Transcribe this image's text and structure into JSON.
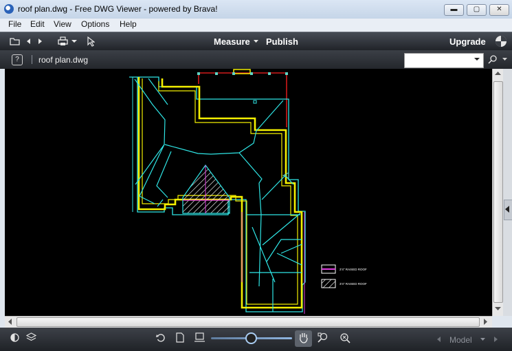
{
  "window": {
    "title": "roof plan.dwg - Free DWG Viewer - powered by Brava!",
    "controls": {
      "minimize": "▬",
      "maximize": "▢",
      "close": "✕"
    }
  },
  "menu": [
    "File",
    "Edit",
    "View",
    "Options",
    "Help"
  ],
  "toolbar": {
    "measure_label": "Measure",
    "publish_label": "Publish",
    "upgrade_label": "Upgrade",
    "icons": [
      "open-folder-icon",
      "back-arrow-icon",
      "forward-arrow-icon",
      "print-icon",
      "dropdown-caret-icon",
      "pointer-icon",
      "brava-logo-icon"
    ]
  },
  "docbar": {
    "help_label": "?",
    "file_name": "roof plan.dwg",
    "search_value": "",
    "icons": [
      "search-icon"
    ]
  },
  "drawing": {
    "legend": [
      {
        "text": "2'4\" RAISED ROOF"
      },
      {
        "text": "3'4\" RAISED ROOF"
      }
    ],
    "colors": {
      "cyan": "#2fe6e6",
      "yellow": "#f4f000",
      "red": "#d21a1a",
      "magenta": "#e040e0",
      "white": "#ffffff"
    }
  },
  "statusbar": {
    "model_label": "Model",
    "icons": [
      "contrast-icon",
      "layers-icon",
      "rotate-icon",
      "page-icon",
      "fit-width-icon",
      "zoom-slider",
      "pan-hand-icon",
      "zoom-window-icon",
      "zoom-extents-icon",
      "prev-icon",
      "next-icon"
    ]
  }
}
